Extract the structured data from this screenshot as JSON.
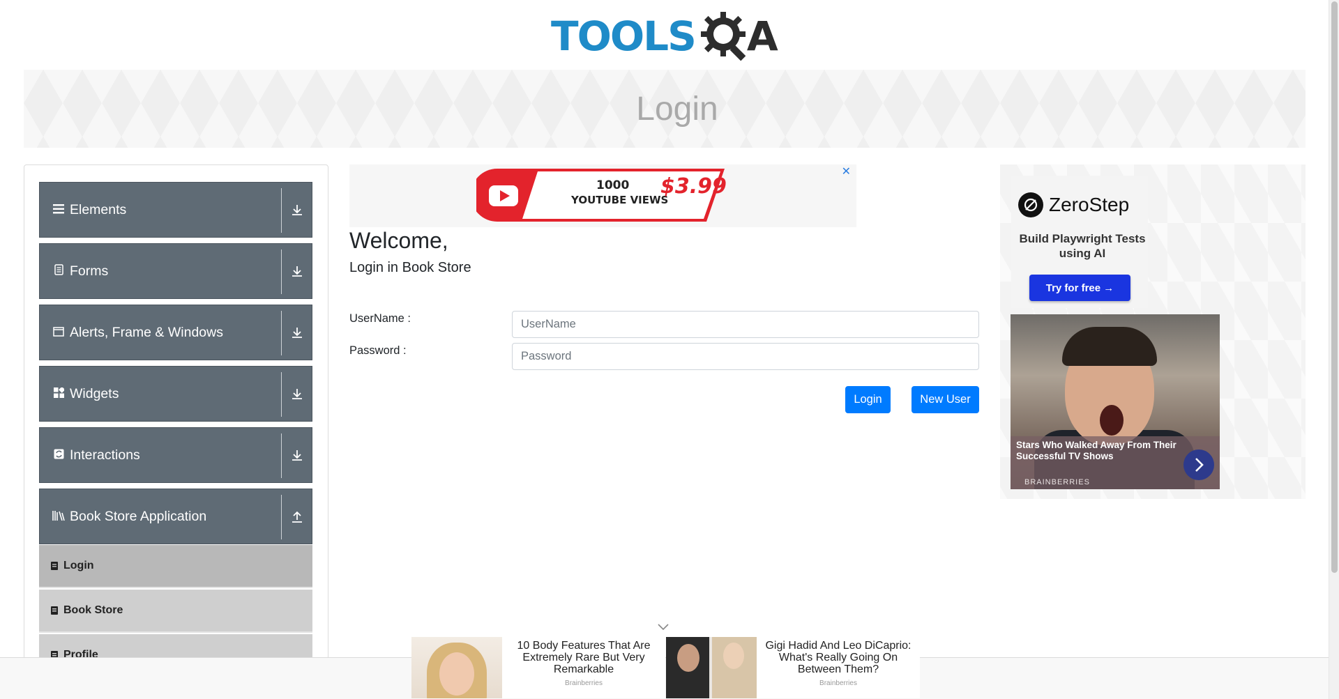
{
  "header": {
    "logo_text": "TOOLS",
    "logo_suffix": "A"
  },
  "banner": {
    "title": "Login"
  },
  "sidebar": {
    "groups": [
      {
        "label": "Elements",
        "icon": "menu-icon",
        "expanded": false
      },
      {
        "label": "Forms",
        "icon": "document-icon",
        "expanded": false
      },
      {
        "label": "Alerts, Frame & Windows",
        "icon": "window-icon",
        "expanded": false
      },
      {
        "label": "Widgets",
        "icon": "widgets-icon",
        "expanded": false
      },
      {
        "label": "Interactions",
        "icon": "interactions-icon",
        "expanded": false
      },
      {
        "label": "Book Store Application",
        "icon": "library-icon",
        "expanded": true
      }
    ],
    "subitems": [
      {
        "label": "Login"
      },
      {
        "label": "Book Store"
      },
      {
        "label": "Profile"
      }
    ]
  },
  "ads": {
    "top": {
      "line1": "1000",
      "line2": "YOUTUBE VIEWS",
      "price": "$3.99",
      "close": "✕"
    },
    "right": {
      "brand": "ZeroStep",
      "tagline": "Build Playwright Tests using AI",
      "cta": "Try for free →",
      "story_title": "Stars Who Walked Away From Their Successful TV Shows",
      "story_source": "BRAINBERRIES"
    },
    "bottom": [
      {
        "title": "10 Body Features That Are Extremely Rare But Very Remarkable",
        "source": "Brainberries"
      },
      {
        "title": "Gigi Hadid And Leo DiCaprio: What's Really Going On Between Them?",
        "source": "Brainberries"
      }
    ]
  },
  "main": {
    "welcome": "Welcome,",
    "subtitle": "Login in Book Store",
    "username_label": "UserName :",
    "username_placeholder": "UserName",
    "username_value": "",
    "password_label": "Password :",
    "password_placeholder": "Password",
    "password_value": "",
    "login_button": "Login",
    "new_user_button": "New User"
  },
  "colors": {
    "accent": "#007bff",
    "sidebar_group": "#5f6b75",
    "banner_title": "#a9a9a9"
  }
}
